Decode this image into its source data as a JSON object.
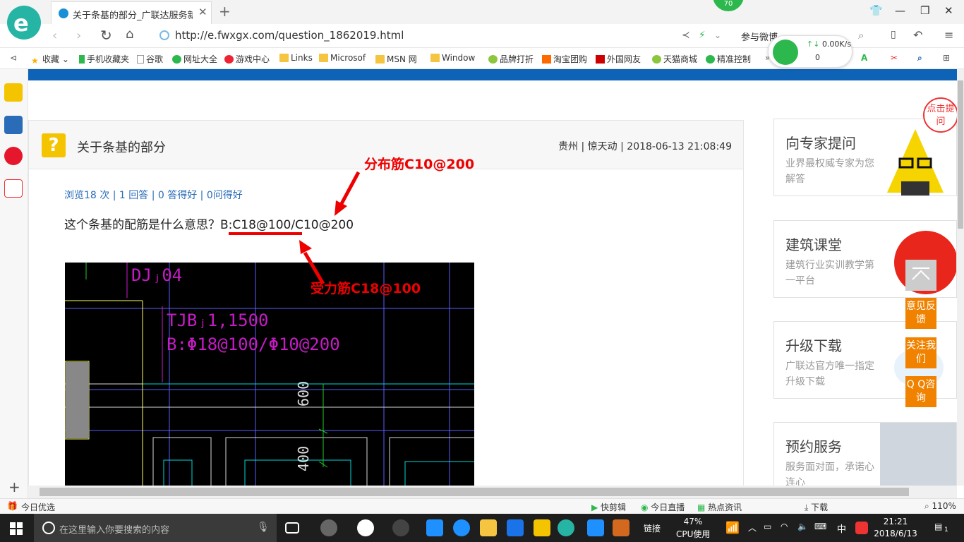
{
  "browser": {
    "tab_title": "关于条基的部分_广联达服务新干线",
    "url": "http://e.fwxgx.com/question_1862019.html",
    "badge": "70",
    "share_text": "参与微博",
    "net_speed": "0.00K/s",
    "net_zero": "0",
    "favorites": [
      "收藏",
      "手机收藏夹",
      "谷歌",
      "网址大全",
      "游戏中心",
      "Links",
      "Microsof",
      "MSN 网",
      "Window",
      "品牌打折",
      "淘宝团购",
      "外国网友",
      "天猫商城",
      "精准控制"
    ]
  },
  "question": {
    "title": "关于条基的部分",
    "meta": "贵州 | 惊天动 | 2018-06-13 21:08:49",
    "stats": "浏览18 次 | 1 回答 | 0 答得好 | 0问得好",
    "text_prefix": "这个条基的配筋是什么意思？",
    "text_rebar": "B:C18@100/C10@200",
    "anno_distribution": "分布筋C10@200",
    "anno_stress": "受力筋C18@100"
  },
  "cad": {
    "label_dj": "DJⱼ04",
    "label_tjb": "TJBⱼ1,1500",
    "label_rebar": "B:Φ18@100/Φ10@200",
    "dim_600": "600",
    "dim_400": "400"
  },
  "sidebar": {
    "cards": [
      {
        "title": "向专家提问",
        "sub": "业界最权威专家为您解答"
      },
      {
        "title": "建筑课堂",
        "sub": "建筑行业实训教学第一平台"
      },
      {
        "title": "升级下载",
        "sub": "广联达官方唯一指定升级下载"
      },
      {
        "title": "预约服务",
        "sub": "服务面对面，承诺心连心"
      }
    ],
    "ask_badge": "点击提问",
    "feedback": "意见反馈",
    "follow": "关注我们",
    "qq": "Q Q咨询"
  },
  "statusbar": {
    "left": "今日优选",
    "items": [
      "快剪辑",
      "今日直播",
      "热点资讯",
      "下载",
      "110%"
    ]
  },
  "taskbar": {
    "search_placeholder": "在这里输入你要搜索的内容",
    "link": "链接",
    "cpu_pct": "47%",
    "cpu_label": "CPU使用",
    "ime": "中",
    "time": "21:21",
    "date": "2018/6/13",
    "notif": "1"
  },
  "colors": {
    "accent_blue": "#0e63b7",
    "annotation_red": "#e00000",
    "side_orange": "#f08200"
  }
}
